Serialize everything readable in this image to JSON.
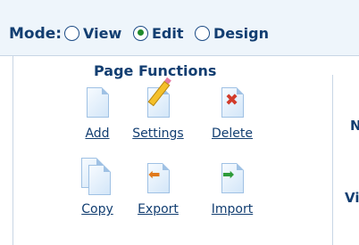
{
  "mode_bar": {
    "title": "Mode:",
    "options": [
      {
        "label": "View",
        "checked": false
      },
      {
        "label": "Edit",
        "checked": true
      },
      {
        "label": "Design",
        "checked": false
      }
    ]
  },
  "page_functions": {
    "title": "Page Functions",
    "actions": [
      {
        "label": "Add",
        "icon": "add-page-icon"
      },
      {
        "label": "Settings",
        "icon": "page-settings-icon"
      },
      {
        "label": "Delete",
        "icon": "delete-page-icon"
      },
      {
        "label": "Copy",
        "icon": "copy-page-icon"
      },
      {
        "label": "Export",
        "icon": "export-page-icon"
      },
      {
        "label": "Import",
        "icon": "import-page-icon"
      }
    ]
  },
  "right_panel": {
    "label_1": "N",
    "label_2": "Vi"
  }
}
